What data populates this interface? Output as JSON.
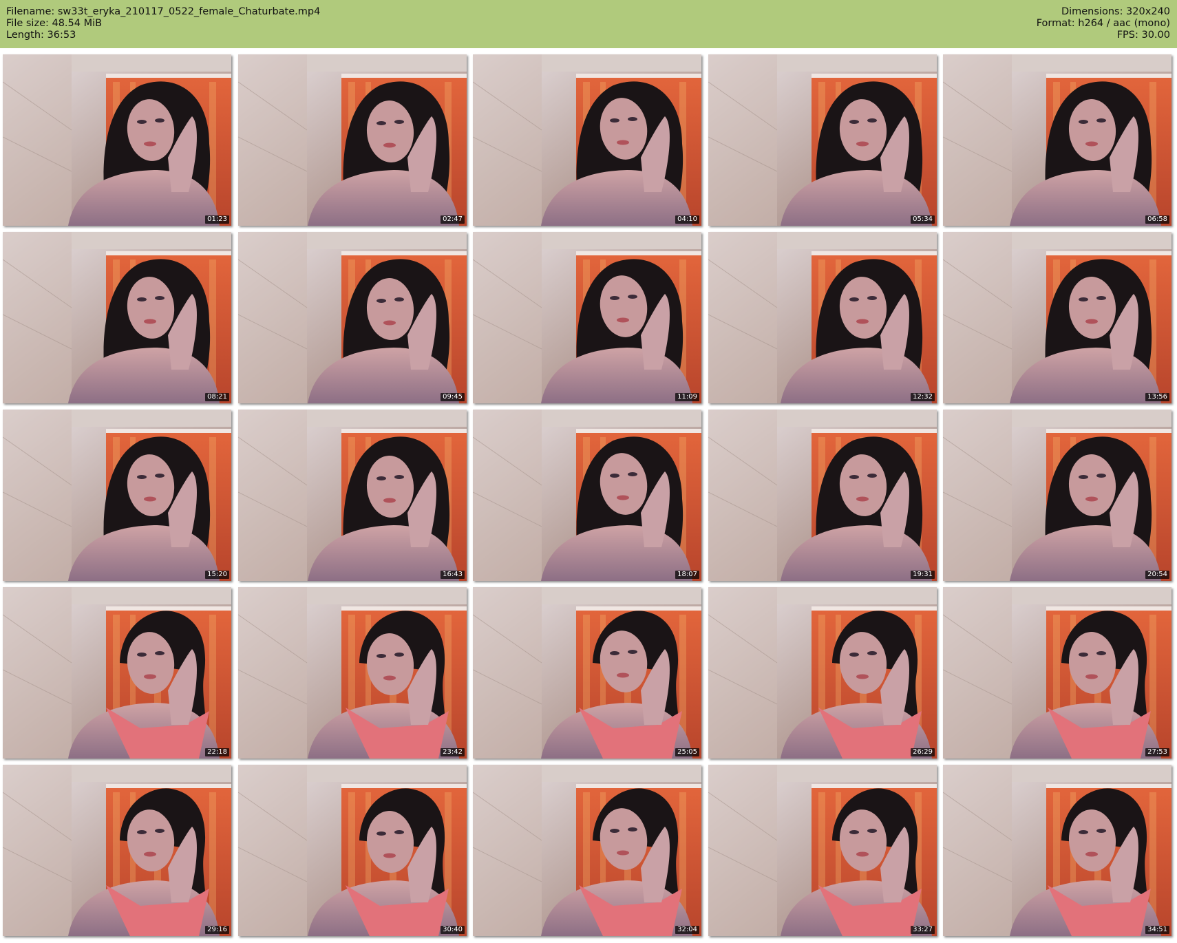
{
  "header": {
    "filename_line": "Filename: sw33t_eryka_210117_0522_female_Chaturbate.mp4",
    "filesize_line": "File size: 48.54 MiB",
    "length_line": "Length: 36:53",
    "dimensions_line": "Dimensions: 320x240",
    "format_line": "Format: h264 / aac (mono)",
    "fps_line": "FPS: 30.00"
  },
  "colors": {
    "header_background": "#b0ca7c",
    "timestamp_background": "#000000",
    "timestamp_text": "#ffffff"
  },
  "thumbnails": [
    {
      "timestamp": "01:23",
      "content": "webcam-frame"
    },
    {
      "timestamp": "02:47",
      "content": "webcam-frame"
    },
    {
      "timestamp": "04:10",
      "content": "webcam-frame"
    },
    {
      "timestamp": "05:34",
      "content": "webcam-frame"
    },
    {
      "timestamp": "06:58",
      "content": "webcam-frame"
    },
    {
      "timestamp": "08:21",
      "content": "webcam-frame"
    },
    {
      "timestamp": "09:45",
      "content": "webcam-frame"
    },
    {
      "timestamp": "11:09",
      "content": "webcam-frame"
    },
    {
      "timestamp": "12:32",
      "content": "webcam-frame"
    },
    {
      "timestamp": "13:56",
      "content": "webcam-frame"
    },
    {
      "timestamp": "15:20",
      "content": "webcam-frame"
    },
    {
      "timestamp": "16:43",
      "content": "webcam-frame"
    },
    {
      "timestamp": "18:07",
      "content": "webcam-frame"
    },
    {
      "timestamp": "19:31",
      "content": "webcam-frame"
    },
    {
      "timestamp": "20:54",
      "content": "webcam-frame"
    },
    {
      "timestamp": "22:18",
      "content": "webcam-frame"
    },
    {
      "timestamp": "23:42",
      "content": "webcam-frame"
    },
    {
      "timestamp": "25:05",
      "content": "webcam-frame"
    },
    {
      "timestamp": "26:29",
      "content": "webcam-frame"
    },
    {
      "timestamp": "27:53",
      "content": "webcam-frame"
    },
    {
      "timestamp": "29:16",
      "content": "webcam-frame"
    },
    {
      "timestamp": "30:40",
      "content": "webcam-frame"
    },
    {
      "timestamp": "32:04",
      "content": "webcam-frame"
    },
    {
      "timestamp": "33:27",
      "content": "webcam-frame"
    },
    {
      "timestamp": "34:51",
      "content": "webcam-frame"
    }
  ]
}
